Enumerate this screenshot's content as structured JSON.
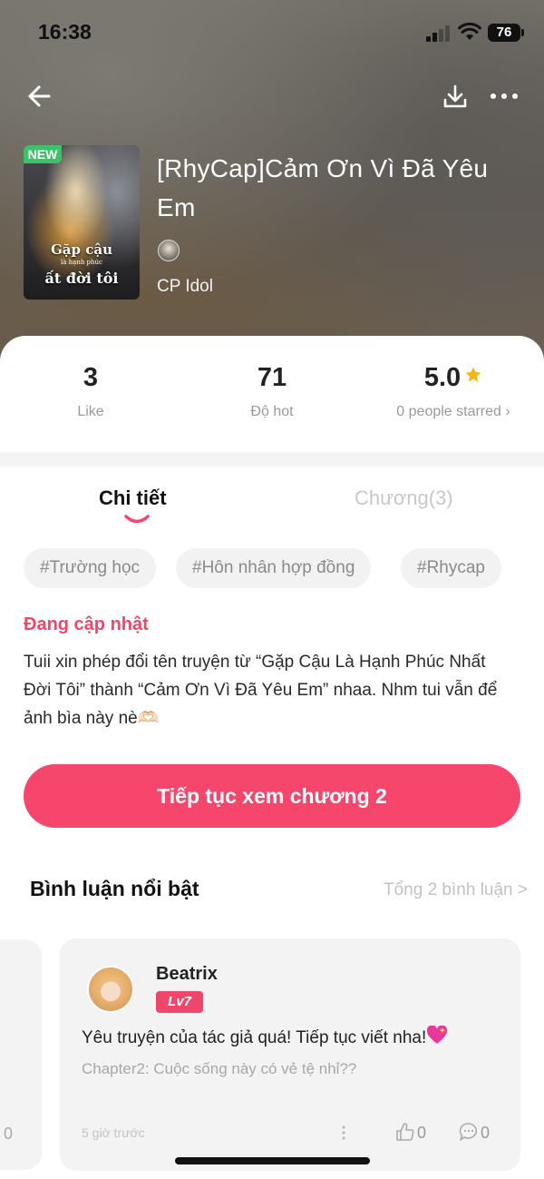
{
  "status_bar": {
    "time": "16:38",
    "battery": "76"
  },
  "book": {
    "badge": "NEW",
    "cover_text_line1": "Gặp cậu",
    "cover_text_line2": "là hạnh phúc",
    "cover_text_line3": "ất đời tôi",
    "title": "[RhyCap]Cảm Ơn Vì Đã Yêu Em",
    "author": "CP Idol"
  },
  "stats": [
    {
      "value": "3",
      "label": "Like"
    },
    {
      "value": "71",
      "label": "Độ hot"
    },
    {
      "value": "5.0",
      "label": "0 people starred ›"
    }
  ],
  "tabs": [
    {
      "label": "Chi tiết",
      "active": true
    },
    {
      "label": "Chương(3)",
      "active": false
    }
  ],
  "tags": [
    "#Trường học",
    "#Hôn nhân hợp đồng",
    "#Rhycap"
  ],
  "update": {
    "title": "Đang cập nhật",
    "text": "Tuii xin phép đổi tên truyện từ “Gặp Cậu Là Hạnh Phúc Nhất Đời Tôi” thành “Cảm Ơn Vì Đã Yêu Em” nhaa. Nhm tui vẫn để ảnh bìa này nè🫶🏻"
  },
  "cta_label": "Tiếp tục xem chương 2",
  "comments": {
    "title": "Bình luận nổi bật",
    "total": "Tổng 2 bình luận >",
    "prev_card_count": "0",
    "items": [
      {
        "user": "Beatrix",
        "level": "Lv7",
        "text": "Yêu truyện của tác giả quá! Tiếp tục viết nha!",
        "chapter": "Chapter2: Cuộc sống này có vẻ tệ nhỉ??",
        "time": "5 giờ trước",
        "likes": "0",
        "replies": "0"
      }
    ]
  },
  "colors": {
    "accent": "#f6466c",
    "new_badge": "#3bc36a",
    "star": "#f5b417"
  }
}
